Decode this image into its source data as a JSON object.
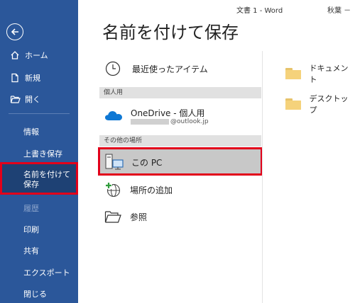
{
  "window": {
    "doc_title": "文書 1  -  Word",
    "user": "秋葉 －"
  },
  "sidebar": {
    "items": [
      {
        "label": "ホーム"
      },
      {
        "label": "新規"
      },
      {
        "label": "開く"
      },
      {
        "label": "情報"
      },
      {
        "label": "上書き保存"
      },
      {
        "label": "名前を付けて保存"
      },
      {
        "label": "履歴"
      },
      {
        "label": "印刷"
      },
      {
        "label": "共有"
      },
      {
        "label": "エクスポート"
      },
      {
        "label": "閉じる"
      }
    ]
  },
  "main": {
    "title": "名前を付けて保存",
    "recent_label": "最近使ったアイテム",
    "section_personal": "個人用",
    "onedrive_label": "OneDrive - 個人用",
    "onedrive_email_domain": "@outlook.jp",
    "section_other": "その他の場所",
    "this_pc_label": "この PC",
    "add_place_label": "場所の追加",
    "browse_label": "参照"
  },
  "folders": [
    {
      "name": "ドキュメント"
    },
    {
      "name": "デスクトップ"
    }
  ]
}
